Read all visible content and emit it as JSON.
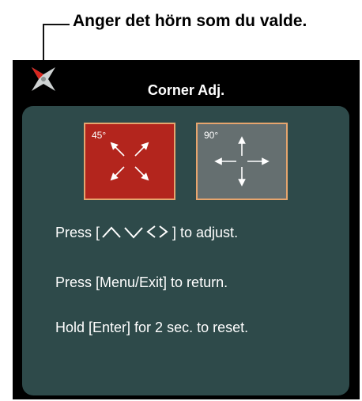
{
  "annotation": {
    "text": "Anger det hörn som du valde."
  },
  "osd": {
    "title": "Corner Adj.",
    "modes": [
      {
        "label": "45°",
        "selected": true,
        "icon": "diagonal-arrows-icon"
      },
      {
        "label": "90°",
        "selected": false,
        "icon": "cross-arrows-icon"
      }
    ],
    "instructions": {
      "adjust_prefix": "Press [",
      "adjust_suffix": "] to adjust.",
      "return": "Press [Menu/Exit] to return.",
      "reset": "Hold [Enter] for 2 sec. to reset."
    },
    "colors": {
      "panel": "#2e4a4a",
      "selected": "#b3251d",
      "unselected": "#656f70",
      "border": "#e6a56e"
    }
  }
}
